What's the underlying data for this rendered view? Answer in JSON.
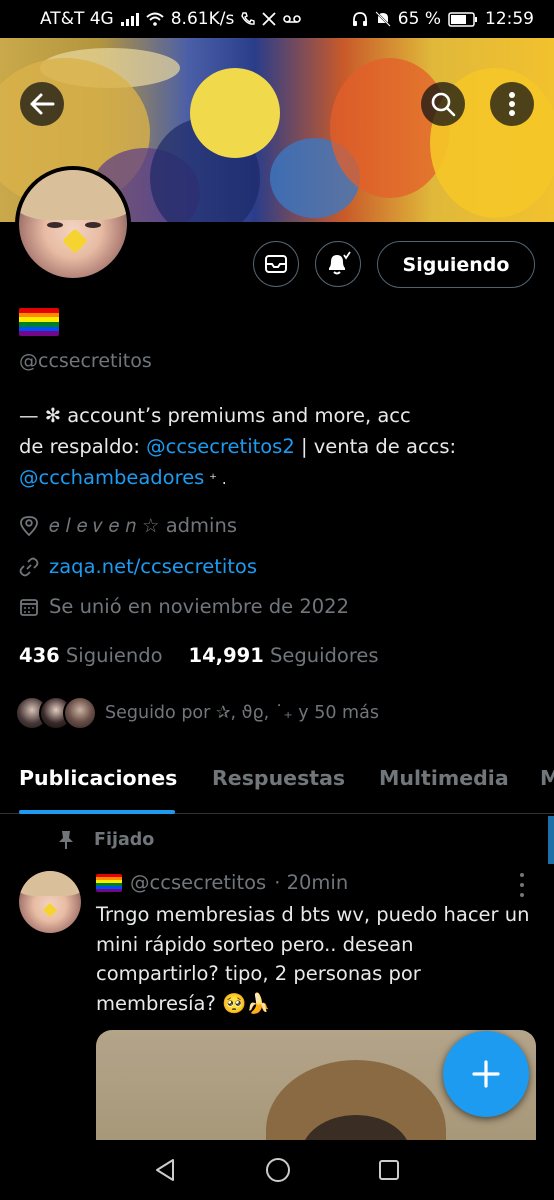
{
  "status_bar": {
    "carrier": "AT&T 4G",
    "speed": "8.61K/s",
    "battery": "65 %",
    "time": "12:59",
    "icons": [
      "signal-icon",
      "wifi-icon",
      "phone-icon",
      "x-logo-icon",
      "voicemail-icon",
      "headphones-icon",
      "mute-icon",
      "battery-icon"
    ]
  },
  "banner": {
    "back_icon": "arrow-left-icon",
    "search_icon": "search-icon",
    "more_icon": "more-vertical-icon"
  },
  "actions": {
    "message_icon": "mail-icon",
    "notify_icon": "bell-icon",
    "follow_label": "Siguiendo"
  },
  "profile": {
    "flag": "rainbow-flag",
    "handle": "@ccsecretitos",
    "bio": {
      "part1": "— ✻ account’s premiums and more,       acc",
      "part2": "de respaldo: ",
      "link1": "@ccsecretitos2",
      "part3": " | venta de accs:",
      "link2": "@ccchambeadores",
      "part4": " ⁺ ."
    },
    "location": "𝑒 𝑙 𝑒 𝑣 𝑒 𝑛 ☆ admins",
    "website": "zaqa.net/ccsecretitos",
    "joined": "Se unió en noviembre de 2022",
    "following_count": "436",
    "following_label": "Siguiendo",
    "followers_count": "14,991",
    "followers_label": "Seguidores",
    "followed_by": "Seguido por ✰, ϑϱ,   ˙₊ y 50 más"
  },
  "tabs": [
    {
      "label": "Publicaciones",
      "active": true
    },
    {
      "label": "Respuestas",
      "active": false
    },
    {
      "label": "Multimedia",
      "active": false
    },
    {
      "label": "M",
      "active": false
    }
  ],
  "pinned_post": {
    "pinned_label": "Fijado",
    "handle": "@ccsecretitos",
    "time": "· 20min",
    "text": "Trngo membresias d bts wv, puedo hacer un mini rápido sorteo pero.. desean compartirlo? tipo, 2 personas por membresía? 🥺🍌"
  },
  "fab_icon": "plus-icon",
  "nav": [
    "back-triangle-icon",
    "home-circle-icon",
    "recents-square-icon"
  ],
  "colors": {
    "accent": "#1d9bf0",
    "muted": "#71767b",
    "text": "#e7e9ea",
    "background": "#000000",
    "border": "#2f3336"
  }
}
